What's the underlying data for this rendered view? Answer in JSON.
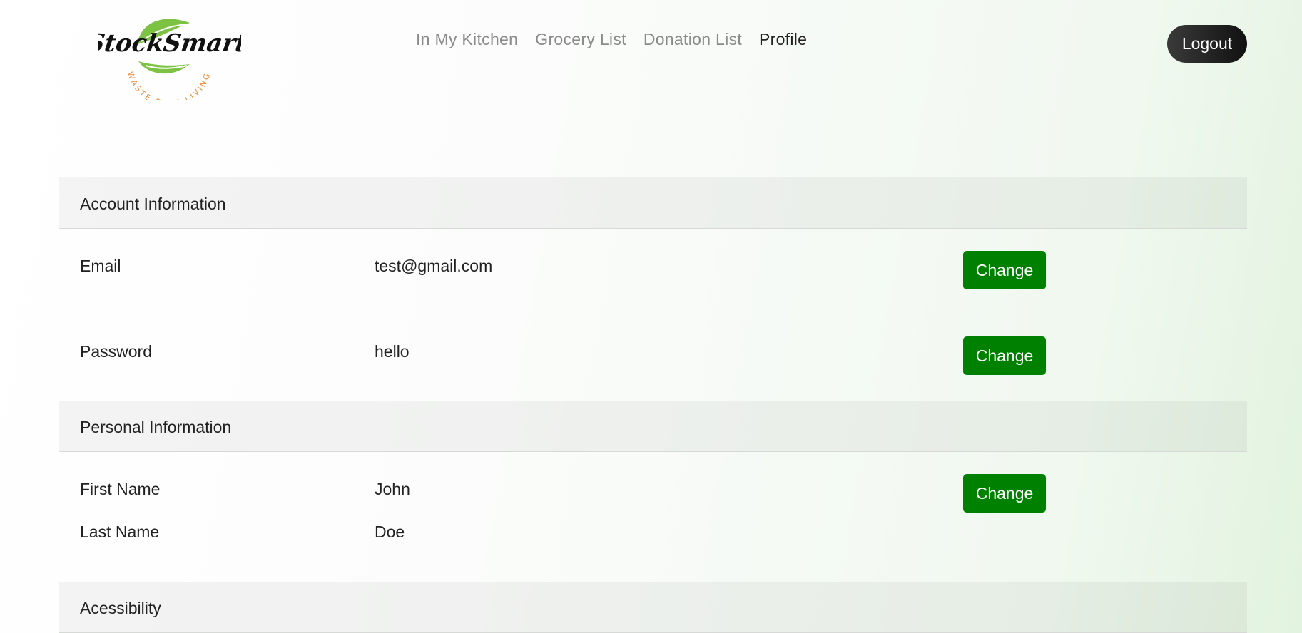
{
  "brand": {
    "name": "StockSmart",
    "tagline": "WASTE FREE LIVING"
  },
  "nav": {
    "items": [
      "In My Kitchen",
      "Grocery List",
      "Donation List",
      "Profile"
    ],
    "active": "Profile"
  },
  "header": {
    "logout_label": "Logout"
  },
  "account": {
    "title": "Account Information",
    "email_label": "Email",
    "email_value": "test@gmail.com",
    "password_label": "Password",
    "password_value": "hello"
  },
  "personal": {
    "title": "Personal Information",
    "first_name_label": "First Name",
    "first_name_value": "John",
    "last_name_label": "Last Name",
    "last_name_value": "Doe"
  },
  "accessibility": {
    "title": "Acessibility"
  },
  "buttons": {
    "change_label": "Change"
  },
  "colors": {
    "accent": "#008000",
    "leaf": "#7dc242",
    "tagline": "#f08a3c",
    "logout": "#222222"
  }
}
